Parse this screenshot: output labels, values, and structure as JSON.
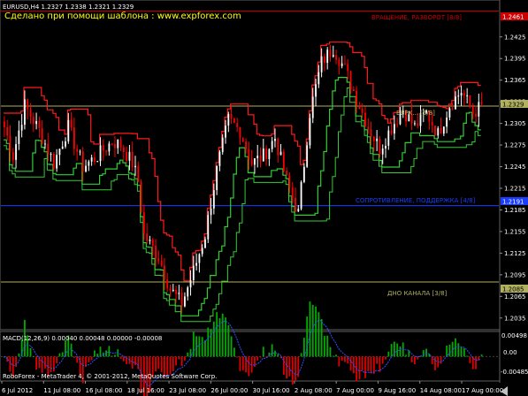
{
  "header": {
    "symbol_line": "EURUSD,H4  1.2327 1.2338 1.2321 1.2329",
    "template_text": "Сделано при помощи шаблона : www.expforex.com"
  },
  "levels": {
    "top_label": "ВРАЩЕНИЕ, РАЗВОРОТ [8/8]",
    "top_price": "1.2461",
    "upper_label": "ВЕРХ... [5/8]",
    "upper_price": "1.2329",
    "mid_label": "СОПРОТИВЛЕНИЕ, ПОДДЕРЖКА [4/8]",
    "mid_price": "1.2191",
    "bottom_label": "ДНО КАНАЛА [3/8]",
    "bottom_price": "1.2085"
  },
  "macd": {
    "label": "MACD(12,26,9) 0.00040 0.00048 0.00000 -0.00008",
    "ticks": [
      "0.00498",
      "0.00",
      "-0.00485"
    ]
  },
  "footer": {
    "copyright": "RoboForex - MetaTrader 4, © 2001-2012, MetaQuotes Software Corp."
  },
  "colors": {
    "bull": "#ffffff",
    "bear": "#ff0000",
    "band_green": "#33cc33",
    "band_red": "#ff1a1a",
    "level_red": "#cc0000",
    "level_khaki": "#b0b060",
    "level_blue": "#1a3cff",
    "header_yellow": "#ffff00"
  },
  "chart_data": {
    "type": "candlestick",
    "symbol": "EURUSD",
    "timeframe": "H4",
    "y_ticks": [
      "1.2425",
      "1.2395",
      "1.2365",
      "1.2335",
      "1.2305",
      "1.2275",
      "1.2245",
      "1.2215",
      "1.2185",
      "1.2155",
      "1.2125",
      "1.2095",
      "1.2065",
      "1.2035"
    ],
    "ylim": [
      1.202,
      1.2475
    ],
    "x_ticks": [
      "6 Jul 2012",
      "11 Jul 08:00",
      "16 Jul 08:00",
      "18 Jul 16:00",
      "23 Jul 08:00",
      "26 Jul 00:00",
      "30 Jul 16:00",
      "2 Aug 08:00",
      "7 Aug 00:00",
      "9 Aug 16:00",
      "14 Aug 08:00",
      "17 Aug 00:00"
    ],
    "close_anchors": [
      [
        0,
        1.23
      ],
      [
        3,
        1.226
      ],
      [
        7,
        1.233
      ],
      [
        12,
        1.2295
      ],
      [
        17,
        1.225
      ],
      [
        22,
        1.23
      ],
      [
        27,
        1.2245
      ],
      [
        32,
        1.226
      ],
      [
        37,
        1.228
      ],
      [
        40,
        1.2275
      ],
      [
        44,
        1.225
      ],
      [
        46,
        1.2225
      ],
      [
        48,
        1.215
      ],
      [
        53,
        1.212
      ],
      [
        57,
        1.2075
      ],
      [
        61,
        1.2055
      ],
      [
        65,
        1.21
      ],
      [
        69,
        1.215
      ],
      [
        73,
        1.224
      ],
      [
        77,
        1.231
      ],
      [
        81,
        1.2295
      ],
      [
        85,
        1.225
      ],
      [
        89,
        1.226
      ],
      [
        93,
        1.2285
      ],
      [
        97,
        1.2225
      ],
      [
        101,
        1.218
      ],
      [
        105,
        1.232
      ],
      [
        109,
        1.239
      ],
      [
        113,
        1.241
      ],
      [
        117,
        1.238
      ],
      [
        121,
        1.234
      ],
      [
        125,
        1.23
      ],
      [
        129,
        1.227
      ],
      [
        133,
        1.23
      ],
      [
        137,
        1.2325
      ],
      [
        141,
        1.23
      ],
      [
        145,
        1.232
      ],
      [
        149,
        1.229
      ],
      [
        153,
        1.233
      ],
      [
        157,
        1.235
      ],
      [
        161,
        1.232
      ],
      [
        164,
        1.2329
      ]
    ],
    "macd_range": [
      -0.00485,
      0.00498
    ]
  }
}
